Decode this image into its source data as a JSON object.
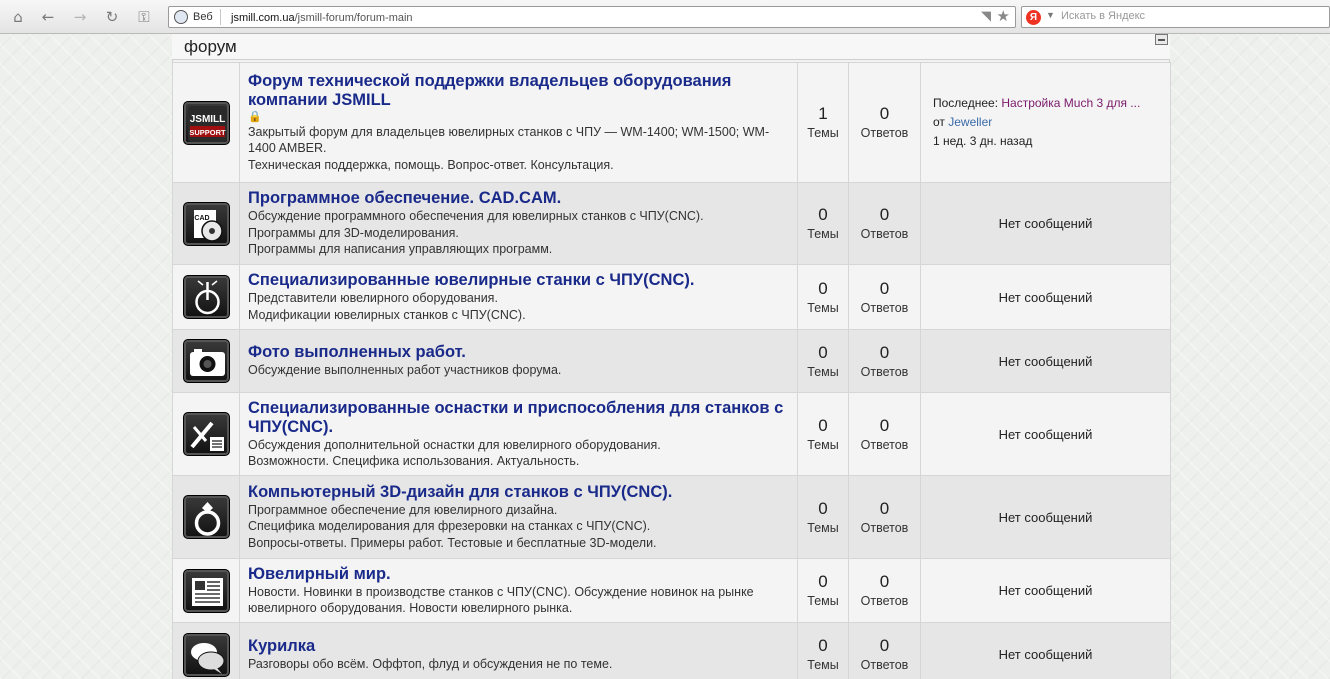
{
  "browser": {
    "scheme_label": "Веб",
    "url_host": "jsmill.com.ua",
    "url_path": "/jsmill-forum/forum-main",
    "search_badge": "Я",
    "search_placeholder": "Искать в Яндекс"
  },
  "section": {
    "title": "форум"
  },
  "labels": {
    "topics": "Темы",
    "replies": "Ответов",
    "no_messages": "Нет сообщений"
  },
  "forums": [
    {
      "title": "Форум технической поддержки владельцев оборудования компании JSMILL",
      "locked_icon": "lock-icon",
      "desc": [
        "Закрытый форум для владельцев ювелирных станков с ЧПУ — WM-1400; WM-1500; WM-1400 AMBER.",
        "Техническая поддержка, помощь. Вопрос-ответ. Консультация."
      ],
      "topics": "1",
      "replies": "0",
      "last": {
        "prefix": "Последнее:",
        "topic": "Настройка Much 3 для ...",
        "by": "от",
        "user": "Jeweller",
        "ago": "1 нед. 3 дн. назад"
      },
      "icon": "jsmill-support-icon",
      "icon_text": [
        "JSMILL",
        "SUPPORT"
      ]
    },
    {
      "title": "Программное обеспечение. CAD.CAM.",
      "desc": [
        "Обсуждение программного обеспечения для ювелирных станков с ЧПУ(CNC).",
        "Программы для 3D-моделирования.",
        "Программы для написания управляющих программ."
      ],
      "topics": "0",
      "replies": "0",
      "icon": "cad-disc-icon",
      "icon_text": [
        "CAD"
      ]
    },
    {
      "title": "Специализированные ювелирные станки с ЧПУ(CNC).",
      "desc": [
        "Представители ювелирного оборудования.",
        "Модификации ювелирных станков с ЧПУ(CNC)."
      ],
      "topics": "0",
      "replies": "0",
      "icon": "machine-icon"
    },
    {
      "title": "Фото выполненных работ.",
      "desc": [
        "Обсуждение выполненных работ участников форума."
      ],
      "topics": "0",
      "replies": "0",
      "icon": "camera-icon"
    },
    {
      "title": "Специализированные оснастки и приспособления для станков с ЧПУ(CNC).",
      "desc": [
        "Обсуждения дополнительной оснастки для ювелирного оборудования.",
        "Возможности. Специфика использования. Актуальность."
      ],
      "topics": "0",
      "replies": "0",
      "icon": "tools-list-icon"
    },
    {
      "title": "Компьютерный 3D-дизайн для станков с ЧПУ(CNC).",
      "desc": [
        "Программное обеспечение для ювелирного дизайна.",
        "Специфика моделирования для фрезеровки на станках с ЧПУ(CNC).",
        "Вопросы-ответы. Примеры работ. Тестовые и бесплатные 3D-модели."
      ],
      "topics": "0",
      "replies": "0",
      "icon": "ring-icon"
    },
    {
      "title": "Ювелирный мир.",
      "desc": [
        "Новости. Новинки в производстве станков с ЧПУ(CNC). Обсуждение новинок на рынке ювелирного оборудования. Новости ювелирного рынка."
      ],
      "topics": "0",
      "replies": "0",
      "icon": "newspaper-icon"
    },
    {
      "title": "Курилка",
      "desc": [
        "Разговоры обо всём. Оффтоп, флуд и обсуждения не по теме."
      ],
      "topics": "0",
      "replies": "0",
      "icon": "chat-bubbles-icon"
    }
  ]
}
